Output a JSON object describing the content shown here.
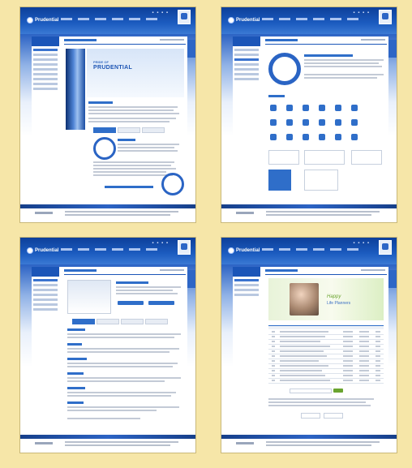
{
  "site": {
    "logo_text": "Prudential"
  },
  "frames": [
    {
      "id": "company-intro",
      "banner_small": "PRIDE OF",
      "banner_big": "PRUDENTIAL",
      "circle_label": "VISION",
      "circle_label2": "MISSION"
    },
    {
      "id": "ci-introduction"
    },
    {
      "id": "product-info"
    },
    {
      "id": "board-list",
      "hero_text": "Happy",
      "hero_text2": "Life Planners"
    }
  ]
}
